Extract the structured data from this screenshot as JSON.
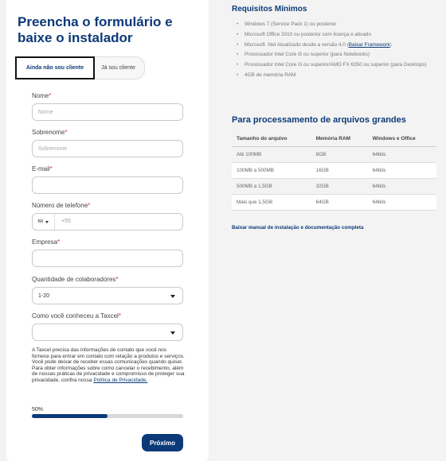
{
  "form": {
    "title": "Preencha o formulário e baixe o instalador",
    "tabs": [
      {
        "label": "Ainda não sou cliente",
        "selected": true
      },
      {
        "label": "Já sou cliente",
        "selected": false
      }
    ],
    "fields": {
      "nome": {
        "label": "Nome",
        "required_mark": "*",
        "placeholder": "Nome",
        "value": ""
      },
      "sobrenome": {
        "label": "Sobrenome",
        "required_mark": "*",
        "placeholder": "Sobrenome",
        "value": ""
      },
      "email": {
        "label": "E-mail",
        "required_mark": "*",
        "value": ""
      },
      "telefone": {
        "label": "Número de telefone",
        "required_mark": "*",
        "country_code": "BR",
        "value": "+55"
      },
      "empresa": {
        "label": "Empresa",
        "required_mark": "*",
        "value": ""
      },
      "colaboradores": {
        "label": "Quantidade de colaboradores",
        "required_mark": "*",
        "value": "1-20"
      },
      "conheceu": {
        "label": "Como você conheceu a Taxcel",
        "required_mark": "*",
        "value": ""
      }
    },
    "consent_text": "A Taxcel precisa das informações de contato que você nos fornece para entrar em contato com relação a produtos e serviços. Você pode deixar de receber essas comunicações quando quiser. Para obter informações sobre como cancelar o recebimento, além de nossas práticas de privacidade e compromisso de proteger sua privacidade, confira nossa",
    "privacy_link": "Política de Privacidade.",
    "progress": {
      "label": "50%",
      "percent": 50
    },
    "next_button": "Próximo"
  },
  "requirements": {
    "title": "Requisitos Mínimos",
    "items": [
      "Windows 7 (Service Pack 1) ou posterior",
      "Microsoft Office 2010 ou posterior com licença e ativado",
      "Processador Intel Core i5 ou superior (para Notebooks)",
      "Processador Intel Core i3 ou superior/AMD FX 6350 ou superior (para Desktops)",
      "4GB de memória RAM"
    ],
    "net_item_prefix": "Microsoft .Net Atualizado desde a versão 4.0 (",
    "net_item_link": "Baixar Framework",
    "net_item_suffix": ")"
  },
  "processing": {
    "title": "Para processamento de arquivos grandes",
    "headers": [
      "Tamanho do arquivo",
      "Memória RAM",
      "Windows e Office"
    ],
    "rows": [
      [
        "Até 100MB",
        "8GB",
        "64bits"
      ],
      [
        "100MB a 500MB",
        "16GB",
        "64bits"
      ],
      [
        "500MB a 1,5GB",
        "32GB",
        "64bits"
      ],
      [
        "Mais que 1,5GB",
        "64GB",
        "64bits"
      ]
    ],
    "manual_link": "Baixar manual de instalação e documentação completa"
  },
  "colors": {
    "brand_blue": "#0c3a78",
    "required_red": "#dd3333"
  }
}
